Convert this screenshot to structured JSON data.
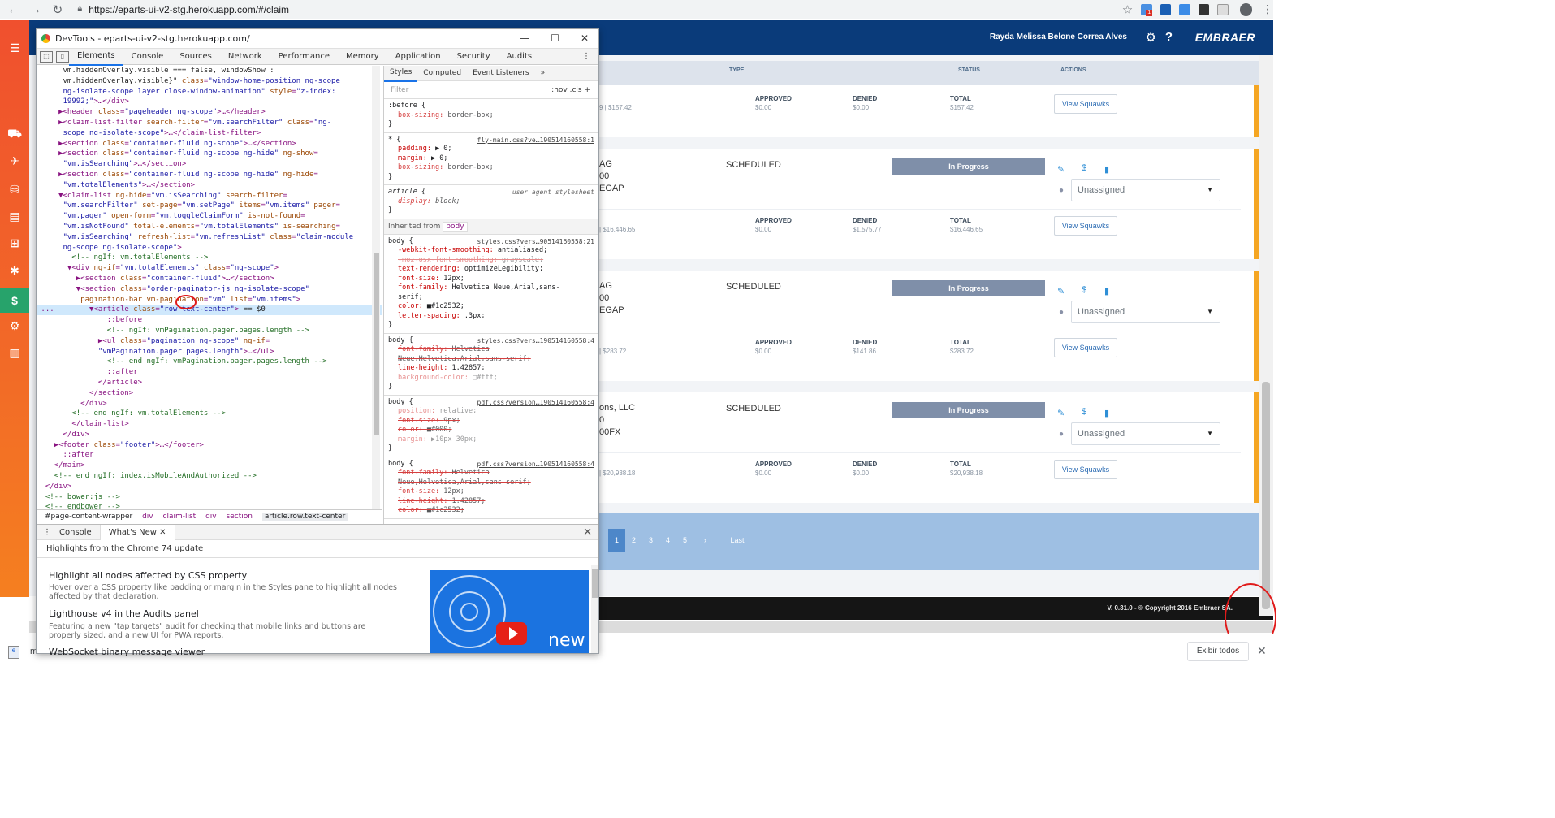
{
  "browser": {
    "url": "https://eparts-ui-v2-stg.herokuapp.com/#/claim",
    "extension_badge": "1"
  },
  "app": {
    "user_name": "Rayda Melissa Belone Correa Alves",
    "brand": "EMBRAER",
    "table_headers": {
      "type": "TYPE",
      "status": "STATUS",
      "actions": "ACTIONS"
    },
    "cards": [
      {
        "approved_label": "APPROVED",
        "approved": "$0.00",
        "denied_label": "DENIED",
        "denied": "$0.00",
        "total_label": "TOTAL",
        "total": "$157.42",
        "left_amount": "9 | $157.42",
        "button": "View Squawks"
      },
      {
        "lines": [
          "AG",
          "00",
          "EGAP"
        ],
        "type": "SCHEDULED",
        "status": "In Progress",
        "assignee": "Unassigned",
        "approved_label": "APPROVED",
        "approved": "$0.00",
        "denied_label": "DENIED",
        "denied": "$1,575.77",
        "total_label": "TOTAL",
        "total": "$16,446.65",
        "left_amount": "| $16,446.65",
        "button": "View Squawks"
      },
      {
        "lines": [
          "AG",
          "00",
          "EGAP"
        ],
        "type": "SCHEDULED",
        "status": "In Progress",
        "assignee": "Unassigned",
        "approved_label": "APPROVED",
        "approved": "$0.00",
        "denied_label": "DENIED",
        "denied": "$141.86",
        "total_label": "TOTAL",
        "total": "$283.72",
        "left_amount": "| $283.72",
        "button": "View Squawks"
      },
      {
        "lines": [
          "ons, LLC",
          "0",
          "00FX"
        ],
        "type": "SCHEDULED",
        "status": "In Progress",
        "assignee": "Unassigned",
        "approved_label": "APPROVED",
        "approved": "$0.00",
        "denied_label": "DENIED",
        "denied": "$0.00",
        "total_label": "TOTAL",
        "total": "$20,938.18",
        "left_amount": "| $20,938.18",
        "button": "View Squawks"
      }
    ],
    "pagination": {
      "pages": [
        "1",
        "2",
        "3",
        "4",
        "5"
      ],
      "next": "›",
      "last": "Last",
      "current": "1"
    },
    "footer": "V. 0.31.0 - © Copyright 2016 Embraer SA."
  },
  "devtools": {
    "title": "DevTools - eparts-ui-v2-stg.herokuapp.com/",
    "tabs": [
      "Elements",
      "Console",
      "Sources",
      "Network",
      "Performance",
      "Memory",
      "Application",
      "Security",
      "Audits"
    ],
    "active_tab": "Elements",
    "breadcrumbs": [
      "#page-content-wrapper",
      "div",
      "claim-list",
      "div",
      "section",
      "article.row.text-center"
    ],
    "styles_tabs": [
      "Styles",
      "Computed",
      "Event Listeners",
      "»"
    ],
    "filter_placeholder": "Filter",
    "filter_toggles": ":hov  .cls  +",
    "inherited_label": "Inherited from",
    "inherited_tag": "body",
    "drawer_tabs": [
      "Console",
      "What's New"
    ],
    "whats_new_heading": "Highlights from the Chrome 74 update",
    "whats_new_items": [
      {
        "title": "Highlight all nodes affected by CSS property",
        "desc": "Hover over a CSS property like padding or margin in the Styles pane to highlight all nodes affected by that declaration."
      },
      {
        "title": "Lighthouse v4 in the Audits panel",
        "desc": "Featuring a new \"tap targets\" audit for checking that mobile links and buttons are properly sized, and a new UI for PWA reports."
      },
      {
        "title": "WebSocket binary message viewer",
        "desc": ""
      }
    ],
    "video_label": "new"
  },
  "download_bar": {
    "file_name": "m",
    "show_all": "Exibir todos"
  }
}
